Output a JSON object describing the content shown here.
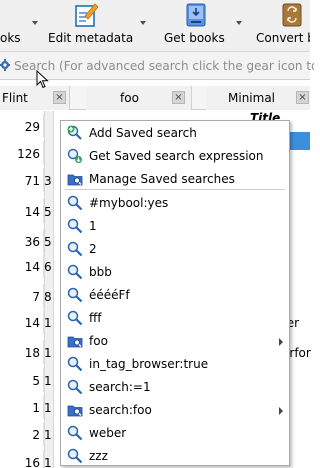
{
  "toolbar": {
    "items": [
      {
        "label": "oks",
        "icon": "add-books-icon"
      },
      {
        "label": "Edit metadata",
        "icon": "edit-metadata-icon"
      },
      {
        "label": "Get books",
        "icon": "get-books-icon"
      },
      {
        "label": "Convert bo",
        "icon": "convert-books-icon"
      }
    ]
  },
  "search": {
    "placeholder": "Search (For advanced search click the gear icon to"
  },
  "columns": {
    "flint": "Flint",
    "foo": "foo",
    "minimal": "Minimal",
    "title": "Title",
    "close_glyph": "×"
  },
  "rows": [
    {
      "num": "29",
      "i": "",
      "title": ""
    },
    {
      "num": "126",
      "i": "",
      "title": ""
    },
    {
      "num": "71",
      "i": "3",
      "title": ""
    },
    {
      "num": "14",
      "i": "5",
      "title": ""
    },
    {
      "num": "36",
      "i": "5",
      "title": ""
    },
    {
      "num": "14",
      "i": "6",
      "title": ""
    },
    {
      "num": "7",
      "i": "8",
      "title": ""
    },
    {
      "num": "14",
      "i": "1",
      "title": "ter"
    },
    {
      "num": "18",
      "i": "1",
      "title": "erfor"
    },
    {
      "num": "5",
      "i": "1",
      "title": ""
    },
    {
      "num": "1",
      "i": "1",
      "title": ""
    },
    {
      "num": "2",
      "i": "1",
      "title": ""
    },
    {
      "num": "16",
      "i": "1",
      "title": ""
    }
  ],
  "menu": {
    "items": [
      {
        "label": "Add Saved search",
        "icon": "add-saved-search-icon",
        "submenu": false
      },
      {
        "label": "Get Saved search expression",
        "icon": "get-saved-search-icon",
        "submenu": false
      },
      {
        "label": "Manage Saved searches",
        "icon": "manage-saved-searches-icon",
        "submenu": false
      },
      {
        "label": "#mybool:yes",
        "icon": "search-icon",
        "submenu": false
      },
      {
        "label": "1",
        "icon": "search-icon",
        "submenu": false
      },
      {
        "label": "2",
        "icon": "search-icon",
        "submenu": false
      },
      {
        "label": "bbb",
        "icon": "search-icon",
        "submenu": false
      },
      {
        "label": "ééééFf",
        "icon": "search-icon",
        "submenu": false
      },
      {
        "label": "fff",
        "icon": "search-icon",
        "submenu": false
      },
      {
        "label": "foo",
        "icon": "folder-icon",
        "submenu": true
      },
      {
        "label": "in_tag_browser:true",
        "icon": "search-icon",
        "submenu": false
      },
      {
        "label": "search:=1",
        "icon": "search-icon",
        "submenu": false
      },
      {
        "label": "search:foo",
        "icon": "folder-icon",
        "submenu": true
      },
      {
        "label": "weber",
        "icon": "search-icon",
        "submenu": false
      },
      {
        "label": "zzz",
        "icon": "search-icon",
        "submenu": false
      }
    ]
  },
  "colors": {
    "selection": "#3c8ede",
    "menu_border": "#a9a9a9",
    "placeholder": "#8c8c8c"
  }
}
